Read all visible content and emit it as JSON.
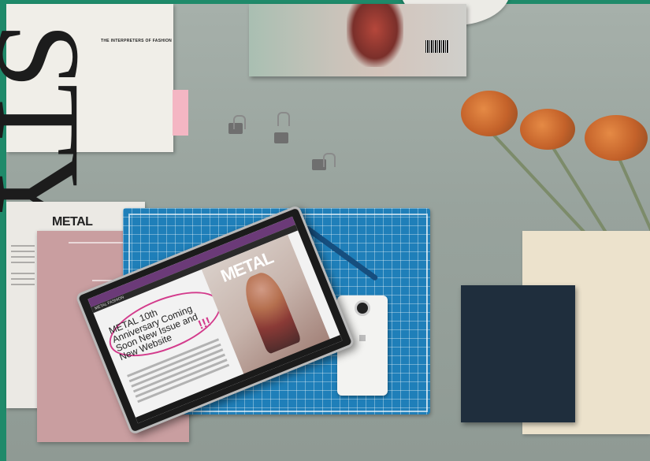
{
  "scene": {
    "magazine_tagline": "THE INTERPRETERS OF FASHION",
    "magazine_letters": "STY",
    "paper_brand": "METAL",
    "tablet": {
      "site_title": "METAL FASHION",
      "hero_brand": "METAL",
      "promo_text": "METAL 10th Anniversary Coming Soon New Issue and New Website",
      "promo_exclaim": "!!!"
    }
  }
}
